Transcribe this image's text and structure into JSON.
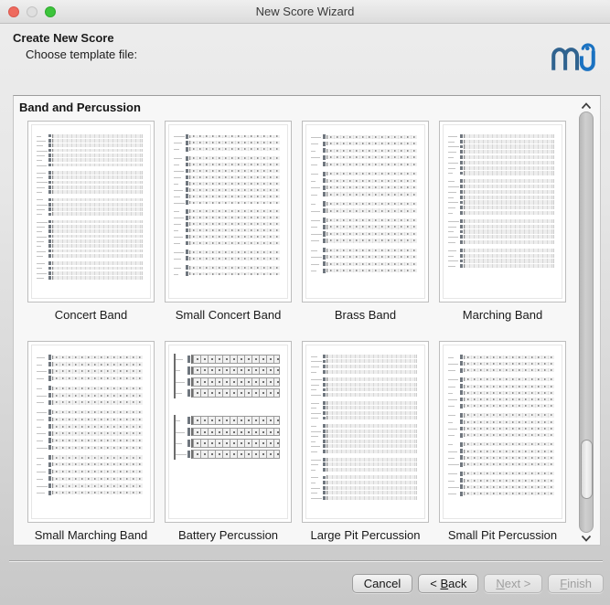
{
  "window": {
    "title": "New Score Wizard",
    "traffic_lights": {
      "close": "#ee6a5e",
      "minimize": "#dfdfdf",
      "zoom": "#3cc43b"
    }
  },
  "header": {
    "title": "Create New Score",
    "subtitle": "Choose template file:"
  },
  "logo": {
    "name": "musescore-logo",
    "m_color": "#30638f",
    "u_color": "#1b72c1"
  },
  "section": {
    "title": "Band and Percussion"
  },
  "templates": [
    {
      "label": "Concert Band",
      "preview": {
        "style": "band",
        "blocks": [
          7,
          5,
          4,
          8,
          4
        ],
        "spread": 0.9
      }
    },
    {
      "label": "Small Concert Band",
      "preview": {
        "style": "dots",
        "blocks": [
          3,
          8,
          6,
          2,
          2
        ],
        "spread": 0.88
      }
    },
    {
      "label": "Brass Band",
      "preview": {
        "style": "dots",
        "blocks": [
          5,
          4,
          2,
          4,
          4
        ],
        "spread": 0.86
      }
    },
    {
      "label": "Marching Band",
      "preview": {
        "style": "band",
        "blocks": [
          8,
          7,
          5,
          4
        ],
        "spread": 0.8
      }
    },
    {
      "label": "Small Marching Band",
      "preview": {
        "style": "dots",
        "blocks": [
          4,
          3,
          6,
          6
        ],
        "spread": 0.88
      }
    },
    {
      "label": "Battery Percussion",
      "preview": {
        "style": "bold",
        "blocks": [
          4,
          4
        ],
        "spread": 0.6,
        "blockGap": 18
      }
    },
    {
      "label": "Large Pit Percussion",
      "preview": {
        "style": "band",
        "blocks": [
          4,
          4,
          4,
          6,
          3,
          5
        ],
        "spread": 0.9
      }
    },
    {
      "label": "Small Pit Percussion",
      "preview": {
        "style": "dots",
        "blocks": [
          3,
          5,
          4,
          4,
          4
        ],
        "spread": 0.88
      }
    }
  ],
  "scrollbar": {
    "up_icon": "chevron-up-icon",
    "down_icon": "chevron-down-icon"
  },
  "footer": {
    "buttons": [
      {
        "name": "cancel",
        "pre": "Cancel",
        "mn": "",
        "post": "",
        "enabled": true
      },
      {
        "name": "back",
        "pre": "< ",
        "mn": "B",
        "post": "ack",
        "enabled": true
      },
      {
        "name": "next",
        "pre": "",
        "mn": "N",
        "post": "ext >",
        "enabled": false
      },
      {
        "name": "finish",
        "pre": "",
        "mn": "F",
        "post": "inish",
        "enabled": false
      }
    ]
  }
}
